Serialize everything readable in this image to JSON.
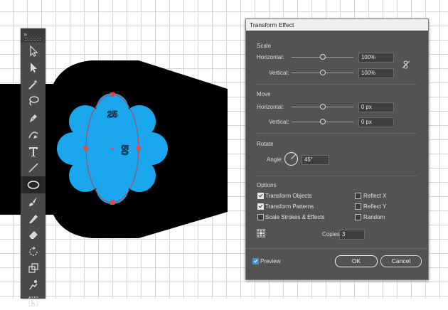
{
  "dialog": {
    "title": "Transform Effect",
    "scale": {
      "label": "Scale",
      "horizontal_label": "Horizontal:",
      "horizontal_value": "100%",
      "horizontal_level": 0.5,
      "vertical_label": "Vertical:",
      "vertical_value": "100%",
      "vertical_level": 0.5,
      "link_icon": "unlink-icon"
    },
    "move": {
      "label": "Move",
      "horizontal_label": "Horizontal:",
      "horizontal_value": "0 px",
      "horizontal_level": 0.5,
      "vertical_label": "Vertical:",
      "vertical_value": "0 px",
      "vertical_level": 0.5
    },
    "rotate": {
      "label": "Rotate",
      "angle_label": "Angle:",
      "angle_value": "45°",
      "angle_degrees": 45
    },
    "options": {
      "label": "Options",
      "transform_objects": {
        "label": "Transform Objects",
        "checked": true
      },
      "transform_patterns": {
        "label": "Transform Patterns",
        "checked": true
      },
      "scale_strokes": {
        "label": "Scale Strokes & Effects",
        "checked": false
      },
      "reflect_x": {
        "label": "Reflect X",
        "checked": false
      },
      "reflect_y": {
        "label": "Reflect Y",
        "checked": false
      },
      "random": {
        "label": "Random",
        "checked": false
      },
      "reference_point_icon": "reference-point-icon"
    },
    "copies_label": "Copies",
    "copies_value": "3",
    "preview": {
      "label": "Preview",
      "checked": true
    },
    "ok_label": "OK",
    "cancel_label": "Cancel"
  },
  "canvas": {
    "label_top": "25",
    "label_right": "50",
    "flower_color": "#1aa7ee",
    "handle_color": "#e8474c",
    "shape_color": "#000000"
  },
  "toolbar": {
    "tools": [
      "selection-tool-icon",
      "direct-selection-tool-icon",
      "magic-wand-tool-icon",
      "lasso-tool-icon",
      "pen-tool-icon",
      "curvature-tool-icon",
      "type-tool-icon",
      "line-segment-tool-icon",
      "ellipse-tool-icon",
      "paintbrush-tool-icon",
      "pencil-tool-icon",
      "eraser-tool-icon",
      "rotate-tool-icon",
      "scale-tool-icon",
      "puppet-warp-tool-icon",
      "free-transform-tool-icon"
    ],
    "active_tool": "ellipse-tool-icon"
  }
}
